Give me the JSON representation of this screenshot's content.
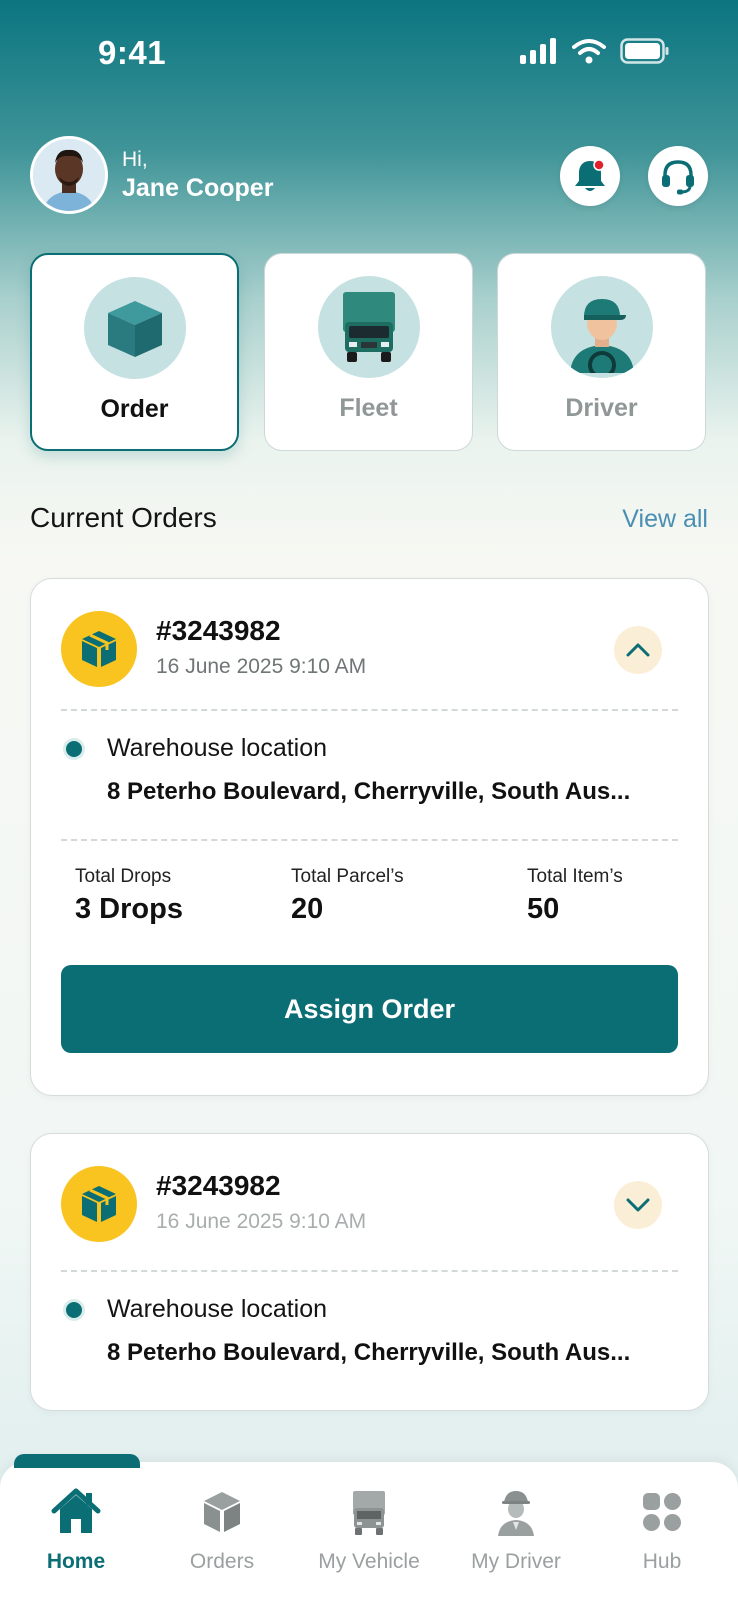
{
  "status_bar": {
    "time": "9:41"
  },
  "greeting": {
    "hi": "Hi,",
    "name": "Jane Cooper"
  },
  "categories": [
    {
      "label": "Order",
      "icon": "package-box-icon",
      "active": true
    },
    {
      "label": "Fleet",
      "icon": "truck-icon",
      "active": false
    },
    {
      "label": "Driver",
      "icon": "driver-icon",
      "active": false
    }
  ],
  "section": {
    "title": "Current Orders",
    "view_all": "View all"
  },
  "orders": [
    {
      "id": "#3243982",
      "date": "16 June 2025 9:10 AM",
      "expanded": true,
      "location_label": "Warehouse location",
      "address": "8 Peterho Boulevard, Cherryville, South Aus...",
      "stats": [
        {
          "label": "Total Drops",
          "value": "3 Drops"
        },
        {
          "label": "Total Parcel’s",
          "value": "20"
        },
        {
          "label": "Total Item’s",
          "value": "50"
        }
      ],
      "action": "Assign Order"
    },
    {
      "id": "#3243982",
      "date": "16 June 2025 9:10 AM",
      "expanded": false,
      "location_label": "Warehouse location",
      "address": "8 Peterho Boulevard, Cherryville, South Aus..."
    }
  ],
  "nav": [
    {
      "label": "Home",
      "icon": "home-icon",
      "active": true
    },
    {
      "label": "Orders",
      "icon": "box-icon",
      "active": false
    },
    {
      "label": "My Vehicle",
      "icon": "vehicle-icon",
      "active": false
    },
    {
      "label": "My Driver",
      "icon": "pilot-driver-icon",
      "active": false
    },
    {
      "label": "Hub",
      "icon": "grid-hub-icon",
      "active": false
    }
  ],
  "colors": {
    "primary": "#0b6e75",
    "accent_yellow": "#f9c420",
    "link": "#4a8fb3",
    "notification_dot": "#e0202a"
  }
}
